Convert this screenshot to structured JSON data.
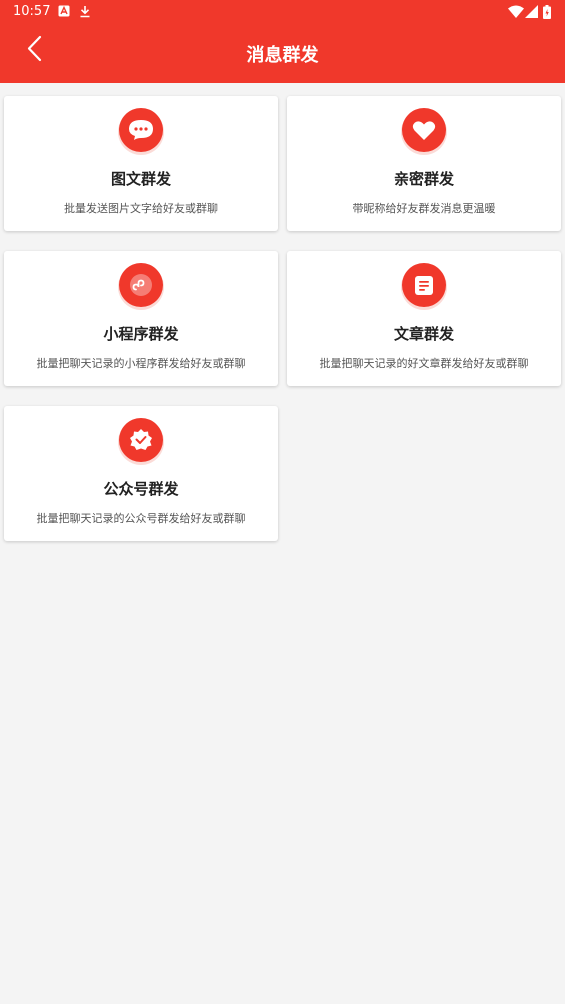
{
  "status": {
    "time": "10:57"
  },
  "header": {
    "title": "消息群发"
  },
  "cards": [
    {
      "title": "图文群发",
      "desc": "批量发送图片文字给好友或群聊",
      "icon": "chat-bubble-icon"
    },
    {
      "title": "亲密群发",
      "desc": "带昵称给好友群发消息更温暖",
      "icon": "heart-icon"
    },
    {
      "title": "小程序群发",
      "desc": "批量把聊天记录的小程序群发给好友或群聊",
      "icon": "mini-program-icon"
    },
    {
      "title": "文章群发",
      "desc": "批量把聊天记录的好文章群发给好友或群聊",
      "icon": "article-icon"
    },
    {
      "title": "公众号群发",
      "desc": "批量把聊天记录的公众号群发给好友或群聊",
      "icon": "official-account-icon"
    }
  ],
  "colors": {
    "accent": "#f0382b",
    "background": "#f4f4f4"
  }
}
